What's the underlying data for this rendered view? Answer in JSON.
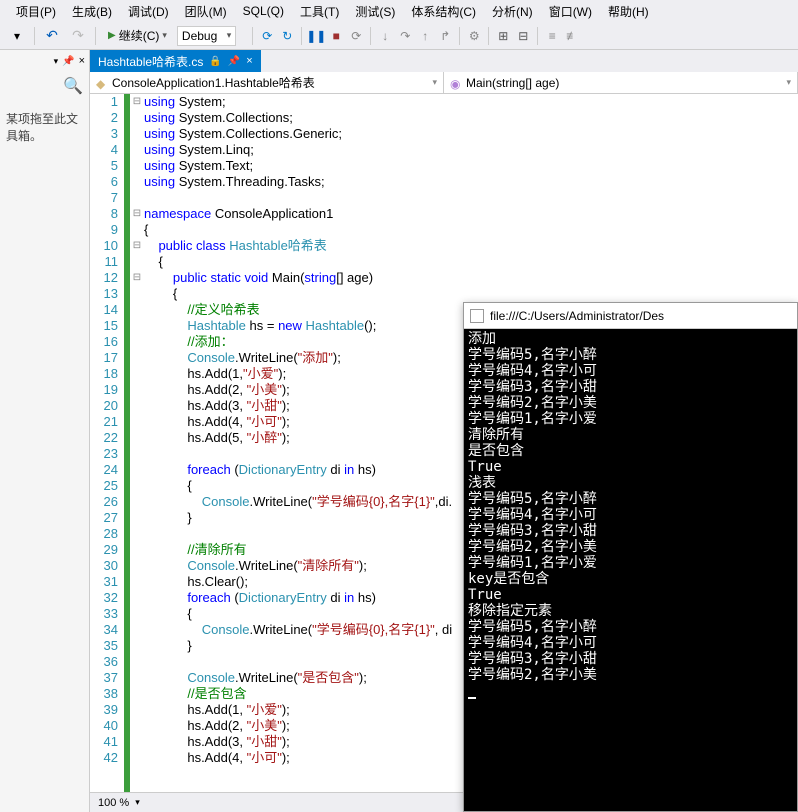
{
  "menu": {
    "items": [
      "项目(P)",
      "生成(B)",
      "调试(D)",
      "团队(M)",
      "SQL(Q)",
      "工具(T)",
      "测试(S)",
      "体系结构(C)",
      "分析(N)",
      "窗口(W)",
      "帮助(H)"
    ]
  },
  "toolbar": {
    "continue": "继续(C)",
    "config": "Debug"
  },
  "left": {
    "drag_text": "某项拖至此文\n具箱。"
  },
  "tab": {
    "title": "Hashtable哈希表.cs"
  },
  "nav": {
    "left": "ConsoleApplication1.Hashtable哈希表",
    "right": "Main(string[] age)"
  },
  "code": {
    "lines": [
      {
        "n": 1,
        "f": "-",
        "t": [
          [
            "kw",
            "using "
          ],
          [
            "",
            "System;"
          ]
        ]
      },
      {
        "n": 2,
        "t": [
          [
            "kw",
            "using "
          ],
          [
            "",
            "System.Collections;"
          ]
        ]
      },
      {
        "n": 3,
        "t": [
          [
            "kw",
            "using "
          ],
          [
            "",
            "System.Collections.Generic;"
          ]
        ]
      },
      {
        "n": 4,
        "t": [
          [
            "kw",
            "using "
          ],
          [
            "",
            "System.Linq;"
          ]
        ]
      },
      {
        "n": 5,
        "t": [
          [
            "kw",
            "using "
          ],
          [
            "",
            "System.Text;"
          ]
        ]
      },
      {
        "n": 6,
        "t": [
          [
            "kw",
            "using "
          ],
          [
            "",
            "System.Threading.Tasks;"
          ]
        ]
      },
      {
        "n": 7,
        "t": [
          [
            "",
            ""
          ]
        ]
      },
      {
        "n": 8,
        "f": "-",
        "t": [
          [
            "kw",
            "namespace "
          ],
          [
            "",
            "ConsoleApplication1"
          ]
        ]
      },
      {
        "n": 9,
        "t": [
          [
            "",
            "{"
          ]
        ]
      },
      {
        "n": 10,
        "f": "-",
        "t": [
          [
            "",
            "    "
          ],
          [
            "kw",
            "public class "
          ],
          [
            "typ",
            "Hashtable哈希表"
          ]
        ]
      },
      {
        "n": 11,
        "t": [
          [
            "",
            "    {"
          ]
        ]
      },
      {
        "n": 12,
        "f": "-",
        "t": [
          [
            "",
            "        "
          ],
          [
            "kw",
            "public static void "
          ],
          [
            "",
            "Main("
          ],
          [
            "kw",
            "string"
          ],
          [
            "",
            "[] age)"
          ]
        ]
      },
      {
        "n": 13,
        "t": [
          [
            "",
            "        {"
          ]
        ]
      },
      {
        "n": 14,
        "t": [
          [
            "",
            "            "
          ],
          [
            "cmt",
            "//定义哈希表"
          ]
        ]
      },
      {
        "n": 15,
        "t": [
          [
            "",
            "            "
          ],
          [
            "typ",
            "Hashtable"
          ],
          [
            "",
            " hs = "
          ],
          [
            "kw",
            "new "
          ],
          [
            "typ",
            "Hashtable"
          ],
          [
            "",
            "();"
          ]
        ]
      },
      {
        "n": 16,
        "t": [
          [
            "",
            "            "
          ],
          [
            "cmt",
            "//添加："
          ]
        ]
      },
      {
        "n": 17,
        "t": [
          [
            "",
            "            "
          ],
          [
            "typ",
            "Console"
          ],
          [
            "",
            ".WriteLine("
          ],
          [
            "str",
            "\"添加\""
          ],
          [
            "",
            ");"
          ]
        ]
      },
      {
        "n": 18,
        "t": [
          [
            "",
            "            hs.Add(1,"
          ],
          [
            "str",
            "\"小爱\""
          ],
          [
            "",
            ");"
          ]
        ]
      },
      {
        "n": 19,
        "t": [
          [
            "",
            "            hs.Add(2, "
          ],
          [
            "str",
            "\"小美\""
          ],
          [
            "",
            ");"
          ]
        ]
      },
      {
        "n": 20,
        "t": [
          [
            "",
            "            hs.Add(3, "
          ],
          [
            "str",
            "\"小甜\""
          ],
          [
            "",
            ");"
          ]
        ]
      },
      {
        "n": 21,
        "t": [
          [
            "",
            "            hs.Add(4, "
          ],
          [
            "str",
            "\"小可\""
          ],
          [
            "",
            ");"
          ]
        ]
      },
      {
        "n": 22,
        "t": [
          [
            "",
            "            hs.Add(5, "
          ],
          [
            "str",
            "\"小醉\""
          ],
          [
            "",
            ");"
          ]
        ]
      },
      {
        "n": 23,
        "t": [
          [
            "",
            ""
          ]
        ]
      },
      {
        "n": 24,
        "t": [
          [
            "",
            "            "
          ],
          [
            "kw",
            "foreach "
          ],
          [
            "",
            "("
          ],
          [
            "typ",
            "DictionaryEntry"
          ],
          [
            "",
            " di "
          ],
          [
            "kw",
            "in"
          ],
          [
            "",
            " hs)"
          ]
        ]
      },
      {
        "n": 25,
        "t": [
          [
            "",
            "            {"
          ]
        ]
      },
      {
        "n": 26,
        "t": [
          [
            "",
            "                "
          ],
          [
            "typ",
            "Console"
          ],
          [
            "",
            ".WriteLine("
          ],
          [
            "str",
            "\"学号编码{0},名字{1}\""
          ],
          [
            "",
            ",di."
          ]
        ]
      },
      {
        "n": 27,
        "t": [
          [
            "",
            "            }"
          ]
        ]
      },
      {
        "n": 28,
        "t": [
          [
            "",
            ""
          ]
        ]
      },
      {
        "n": 29,
        "t": [
          [
            "",
            "            "
          ],
          [
            "cmt",
            "//清除所有"
          ]
        ]
      },
      {
        "n": 30,
        "t": [
          [
            "",
            "            "
          ],
          [
            "typ",
            "Console"
          ],
          [
            "",
            ".WriteLine("
          ],
          [
            "str",
            "\"清除所有\""
          ],
          [
            "",
            ");"
          ]
        ]
      },
      {
        "n": 31,
        "t": [
          [
            "",
            "            hs.Clear();"
          ]
        ]
      },
      {
        "n": 32,
        "t": [
          [
            "",
            "            "
          ],
          [
            "kw",
            "foreach "
          ],
          [
            "",
            "("
          ],
          [
            "typ",
            "DictionaryEntry"
          ],
          [
            "",
            " di "
          ],
          [
            "kw",
            "in"
          ],
          [
            "",
            " hs)"
          ]
        ]
      },
      {
        "n": 33,
        "t": [
          [
            "",
            "            {"
          ]
        ]
      },
      {
        "n": 34,
        "t": [
          [
            "",
            "                "
          ],
          [
            "typ",
            "Console"
          ],
          [
            "",
            ".WriteLine("
          ],
          [
            "str",
            "\"学号编码{0},名字{1}\""
          ],
          [
            "",
            ", di"
          ]
        ]
      },
      {
        "n": 35,
        "t": [
          [
            "",
            "            }"
          ]
        ]
      },
      {
        "n": 36,
        "t": [
          [
            "",
            ""
          ]
        ]
      },
      {
        "n": 37,
        "t": [
          [
            "",
            "            "
          ],
          [
            "typ",
            "Console"
          ],
          [
            "",
            ".WriteLine("
          ],
          [
            "str",
            "\"是否包含\""
          ],
          [
            "",
            ");"
          ]
        ]
      },
      {
        "n": 38,
        "t": [
          [
            "",
            "            "
          ],
          [
            "cmt",
            "//是否包含"
          ]
        ]
      },
      {
        "n": 39,
        "t": [
          [
            "",
            "            hs.Add(1, "
          ],
          [
            "str",
            "\"小爱\""
          ],
          [
            "",
            ");"
          ]
        ]
      },
      {
        "n": 40,
        "t": [
          [
            "",
            "            hs.Add(2, "
          ],
          [
            "str",
            "\"小美\""
          ],
          [
            "",
            ");"
          ]
        ]
      },
      {
        "n": 41,
        "t": [
          [
            "",
            "            hs.Add(3, "
          ],
          [
            "str",
            "\"小甜\""
          ],
          [
            "",
            ");"
          ]
        ]
      },
      {
        "n": 42,
        "t": [
          [
            "",
            "            hs.Add(4, "
          ],
          [
            "str",
            "\"小可\""
          ],
          [
            "",
            ");"
          ]
        ]
      }
    ]
  },
  "zoom": {
    "value": "100 %"
  },
  "console": {
    "title": "file:///C:/Users/Administrator/Des",
    "lines": [
      "添加",
      "学号编码5,名字小醉",
      "学号编码4,名字小可",
      "学号编码3,名字小甜",
      "学号编码2,名字小美",
      "学号编码1,名字小爱",
      "清除所有",
      "是否包含",
      "True",
      "浅表",
      "学号编码5,名字小醉",
      "学号编码4,名字小可",
      "学号编码3,名字小甜",
      "学号编码2,名字小美",
      "学号编码1,名字小爱",
      "key是否包含",
      "True",
      "移除指定元素",
      "学号编码5,名字小醉",
      "学号编码4,名字小可",
      "学号编码3,名字小甜",
      "学号编码2,名字小美"
    ]
  }
}
